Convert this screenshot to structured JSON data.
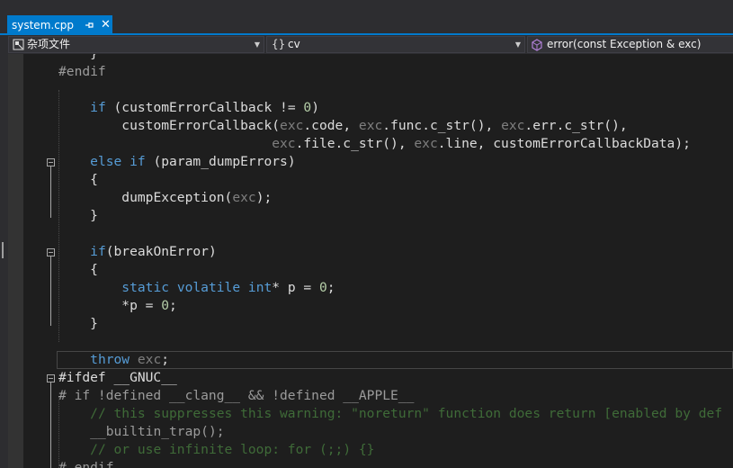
{
  "tab": {
    "title": "system.cpp",
    "pin_icon": "pin-icon",
    "close_label": "✕"
  },
  "nav": {
    "project": "杂项文件",
    "scope": "cv",
    "member": "error(const Exception & exc)"
  },
  "code": {
    "l0": "    }",
    "l1": "#endif",
    "l3_if": "if",
    "l3_rest": " (customErrorCallback != ",
    "l3_num": "0",
    "l3_end": ")",
    "l4_fn": "customErrorCallback",
    "l4_a": "(",
    "l4_exc1": "exc",
    "l4_b": ".code, ",
    "l4_exc2": "exc",
    "l4_c": ".func.c_str(), ",
    "l4_exc3": "exc",
    "l4_d": ".err.c_str(),",
    "l5_exc1": "exc",
    "l5_a": ".file.c_str(), ",
    "l5_exc2": "exc",
    "l5_b": ".line, customErrorCallbackData);",
    "l6_else": "else",
    "l6_if": "if",
    "l6_rest": " (param_dumpErrors)",
    "l7": "{",
    "l8_fn": "dumpException",
    "l8_a": "(",
    "l8_exc": "exc",
    "l8_b": ");",
    "l9": "}",
    "l11_if": "if",
    "l11_rest": "(breakOnError)",
    "l12": "{",
    "l13_static": "static",
    "l13_volatile": "volatile",
    "l13_int": "int",
    "l13_rest": "* p = ",
    "l13_num": "0",
    "l13_end": ";",
    "l14_a": "*p = ",
    "l14_num": "0",
    "l14_b": ";",
    "l15": "}",
    "l17_throw": "throw",
    "l17_exc": "exc",
    "l17_end": ";",
    "l18": "#ifdef __GNUC__",
    "l19": "# if !defined __clang__ && !defined __APPLE__",
    "l20_a": "// this suppresses this warning: ",
    "l20_str": "\"noreturn\"",
    "l20_b": " function does return [enabled by def",
    "l21": "__builtin_trap();",
    "l22": "// or use infinite loop: for (;;) {}",
    "l23": "# endif"
  }
}
